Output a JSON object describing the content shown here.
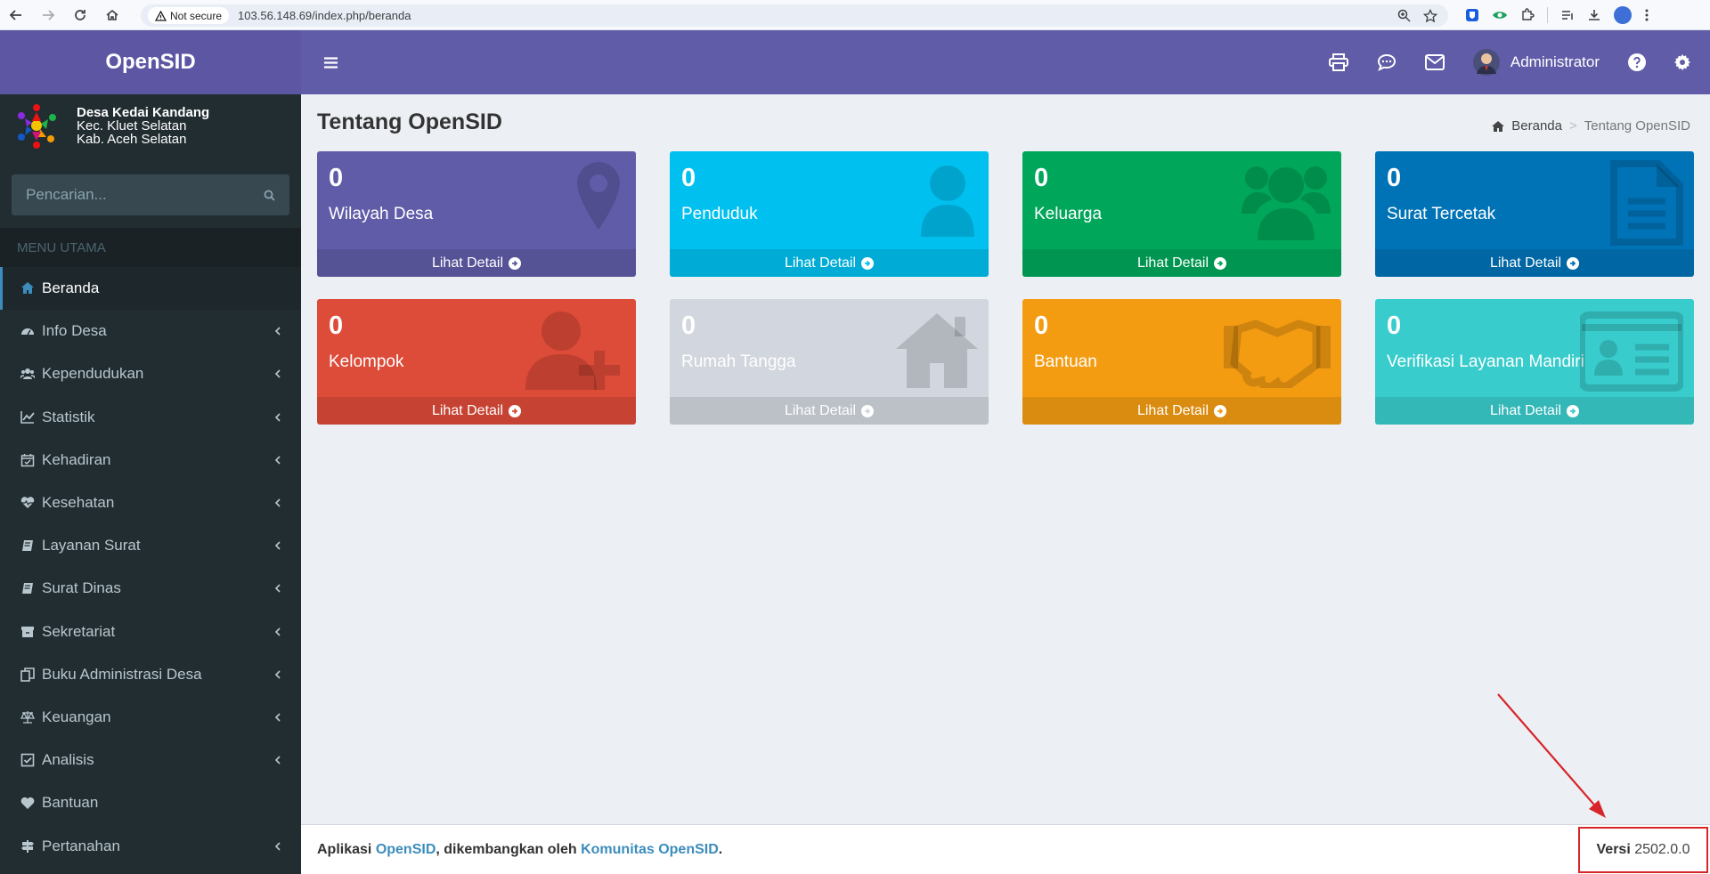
{
  "browser": {
    "security_label": "Not secure",
    "url": "103.56.148.69/index.php/beranda"
  },
  "app": {
    "title": "OpenSID"
  },
  "desa": {
    "name": "Desa Kedai Kandang",
    "kecamatan": "Kec. Kluet Selatan",
    "kabupaten": "Kab. Aceh Selatan"
  },
  "search": {
    "placeholder": "Pencarian..."
  },
  "menu": {
    "header": "MENU UTAMA",
    "items": [
      {
        "label": "Beranda",
        "icon": "home-icon",
        "active": true,
        "submenu": false
      },
      {
        "label": "Info Desa",
        "icon": "dashboard-icon",
        "submenu": true
      },
      {
        "label": "Kependudukan",
        "icon": "users-icon",
        "submenu": true
      },
      {
        "label": "Statistik",
        "icon": "line-chart-icon",
        "submenu": true
      },
      {
        "label": "Kehadiran",
        "icon": "calendar-check-icon",
        "submenu": true
      },
      {
        "label": "Kesehatan",
        "icon": "heartbeat-icon",
        "submenu": true
      },
      {
        "label": "Layanan Surat",
        "icon": "book-icon",
        "submenu": true
      },
      {
        "label": "Surat Dinas",
        "icon": "book-icon",
        "submenu": true
      },
      {
        "label": "Sekretariat",
        "icon": "archive-icon",
        "submenu": true
      },
      {
        "label": "Buku Administrasi Desa",
        "icon": "copy-icon",
        "submenu": true
      },
      {
        "label": "Keuangan",
        "icon": "balance-scale-icon",
        "submenu": true
      },
      {
        "label": "Analisis",
        "icon": "check-square-icon",
        "submenu": true
      },
      {
        "label": "Bantuan",
        "icon": "heart-icon",
        "submenu": false
      },
      {
        "label": "Pertanahan",
        "icon": "map-signs-icon",
        "submenu": true
      }
    ]
  },
  "topnav": {
    "user_name": "Administrator"
  },
  "page": {
    "title": "Tentang OpenSID"
  },
  "breadcrumb": {
    "home": "Beranda",
    "current": "Tentang OpenSID"
  },
  "cards": [
    {
      "value": "0",
      "label": "Wilayah Desa",
      "link": "Lihat Detail",
      "color": "#605ca8",
      "icon": "map-marker-icon"
    },
    {
      "value": "0",
      "label": "Penduduk",
      "link": "Lihat Detail",
      "color": "#00c0ef",
      "icon": "user-icon"
    },
    {
      "value": "0",
      "label": "Keluarga",
      "link": "Lihat Detail",
      "color": "#00a65a",
      "icon": "users-icon"
    },
    {
      "value": "0",
      "label": "Surat Tercetak",
      "link": "Lihat Detail",
      "color": "#0073b7",
      "icon": "file-text-icon"
    },
    {
      "value": "0",
      "label": "Kelompok",
      "link": "Lihat Detail",
      "color": "#dd4b39",
      "icon": "user-plus-icon"
    },
    {
      "value": "0",
      "label": "Rumah Tangga",
      "link": "Lihat Detail",
      "color": "#d2d6de",
      "icon": "home-icon"
    },
    {
      "value": "0",
      "label": "Bantuan",
      "link": "Lihat Detail",
      "color": "#f39c12",
      "icon": "handshake-icon"
    },
    {
      "value": "0",
      "label": "Verifikasi Layanan Mandiri",
      "link": "Lihat Detail",
      "color": "#39cccc",
      "icon": "id-card-icon"
    }
  ],
  "footer": {
    "prefix": "Aplikasi",
    "app_link": "OpenSID",
    "middle": ", dikembangkan oleh",
    "community_link": "Komunitas OpenSID",
    "suffix": ".",
    "version_label": "Versi",
    "version": "2502.0.0"
  },
  "colors": {
    "brand": "#605ca8",
    "logo_bar": "#5c56a3",
    "sidebar": "#222d32",
    "link": "#3c8dbc",
    "annotation": "#d7262a"
  }
}
